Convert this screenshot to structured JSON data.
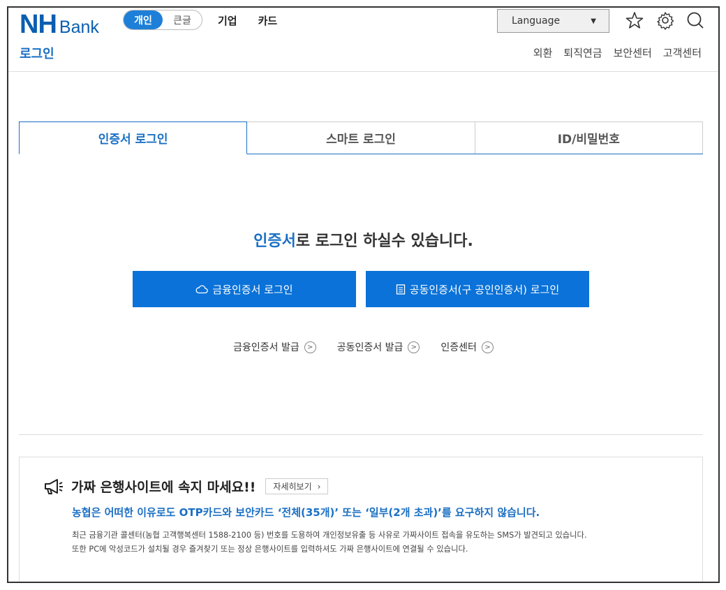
{
  "header": {
    "logo_mark": "NH",
    "logo_text": "Bank",
    "mode_options": [
      "개인",
      "큰글"
    ],
    "nav": [
      "기업",
      "카드"
    ],
    "language_label": "Language",
    "page_title": "로그인",
    "util_links": [
      "외환",
      "퇴직연금",
      "보안센터",
      "고객센터"
    ]
  },
  "tabs": [
    {
      "label": "인증서 로그인",
      "active": true
    },
    {
      "label": "스마트 로그인",
      "active": false
    },
    {
      "label": "ID/비밀번호",
      "active": false
    }
  ],
  "main": {
    "headline_highlight": "인증서",
    "headline_rest": "로 로그인 하실수 있습니다.",
    "buttons": [
      "금융인증서 로그인",
      "공동인증서(구 공인인증서) 로그인"
    ],
    "links": [
      "금융인증서 발급",
      "공동인증서 발급",
      "인증센터"
    ]
  },
  "warning": {
    "title": "가짜 은행사이트에 속지 마세요!!",
    "detail_label": "자세히보기",
    "blue_text": "농협은 어떠한 이유로도 OTP카드와 보안카드 ‘전체(35개)’ 또는 ‘일부(2개 초과)’를 요구하지 않습니다.",
    "line1": "최근 금융기관 콜센터(농협 고객행복센터 1588-2100 등) 번호를 도용하여 개인정보유출 등 사유로 가짜사이트 접속을 유도하는 SMS가 발견되고 있습니다.",
    "line2": "또한 PC에 악성코드가 설치될 경우 즐겨찾기 또는 정상 은행사이트를 입력하셔도 가짜 은행사이트에 연결될 수 있습니다."
  },
  "colors": {
    "brand": "#0a5eb0",
    "accent": "#1a6fc4",
    "button": "#0a72d8"
  },
  "icons": [
    "star-icon",
    "gear-icon",
    "search-icon",
    "cloud-icon",
    "document-icon",
    "megaphone-icon",
    "chevron-right-icon"
  ]
}
